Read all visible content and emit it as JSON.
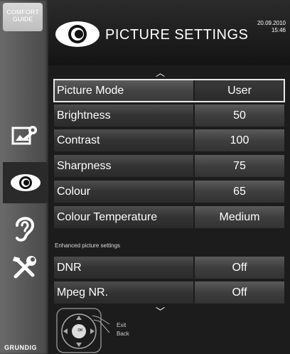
{
  "sidebar": {
    "comfort_guide": "COMFORT GUIDE",
    "brand": "GRUNDIG",
    "icons": [
      "settings-image-icon",
      "eye-icon",
      "ear-icon",
      "tools-icon"
    ],
    "active": "eye-icon"
  },
  "header": {
    "title": "PICTURE SETTINGS",
    "date": "20.09.2010",
    "time": "15:46"
  },
  "menu": {
    "rows": [
      {
        "label": "Picture Mode",
        "value": "User",
        "selected": true
      },
      {
        "label": "Brightness",
        "value": "50"
      },
      {
        "label": "Contrast",
        "value": "100"
      },
      {
        "label": "Sharpness",
        "value": "75"
      },
      {
        "label": "Colour",
        "value": "65"
      },
      {
        "label": "Colour Temperature",
        "value": "Medium"
      }
    ],
    "section_label": "Enhanced picture settings",
    "enhanced_rows": [
      {
        "label": "DNR",
        "value": "Off"
      },
      {
        "label": "Mpeg NR.",
        "value": "Off"
      }
    ]
  },
  "footer": {
    "ok_label": "OK",
    "exit_label": "Exit",
    "back_label": "Back"
  },
  "colors": {
    "background": "#1c1c1c",
    "row_label": "#3c3c3c",
    "row_value": "#4a4a4a",
    "text": "#ffffff"
  }
}
